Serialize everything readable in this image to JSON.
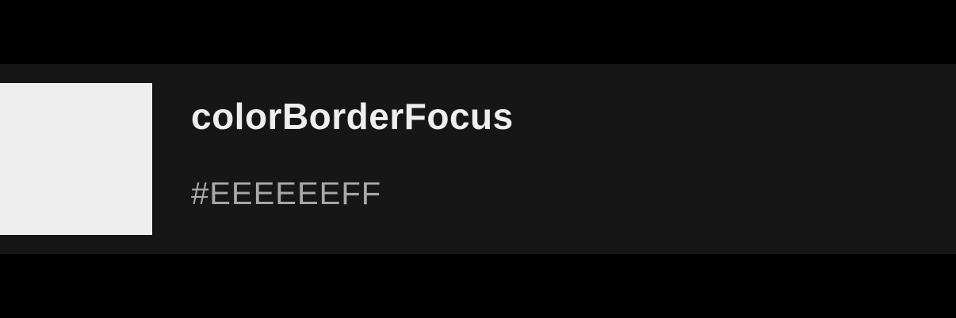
{
  "token": {
    "name": "colorBorderFocus",
    "value": "#EEEEEEFF",
    "swatch_color": "#EEEEEE"
  },
  "colors": {
    "page_background": "#000000",
    "row_background": "#161616",
    "name_text": "#EEEEEE",
    "value_text": "#A8A8A8"
  }
}
